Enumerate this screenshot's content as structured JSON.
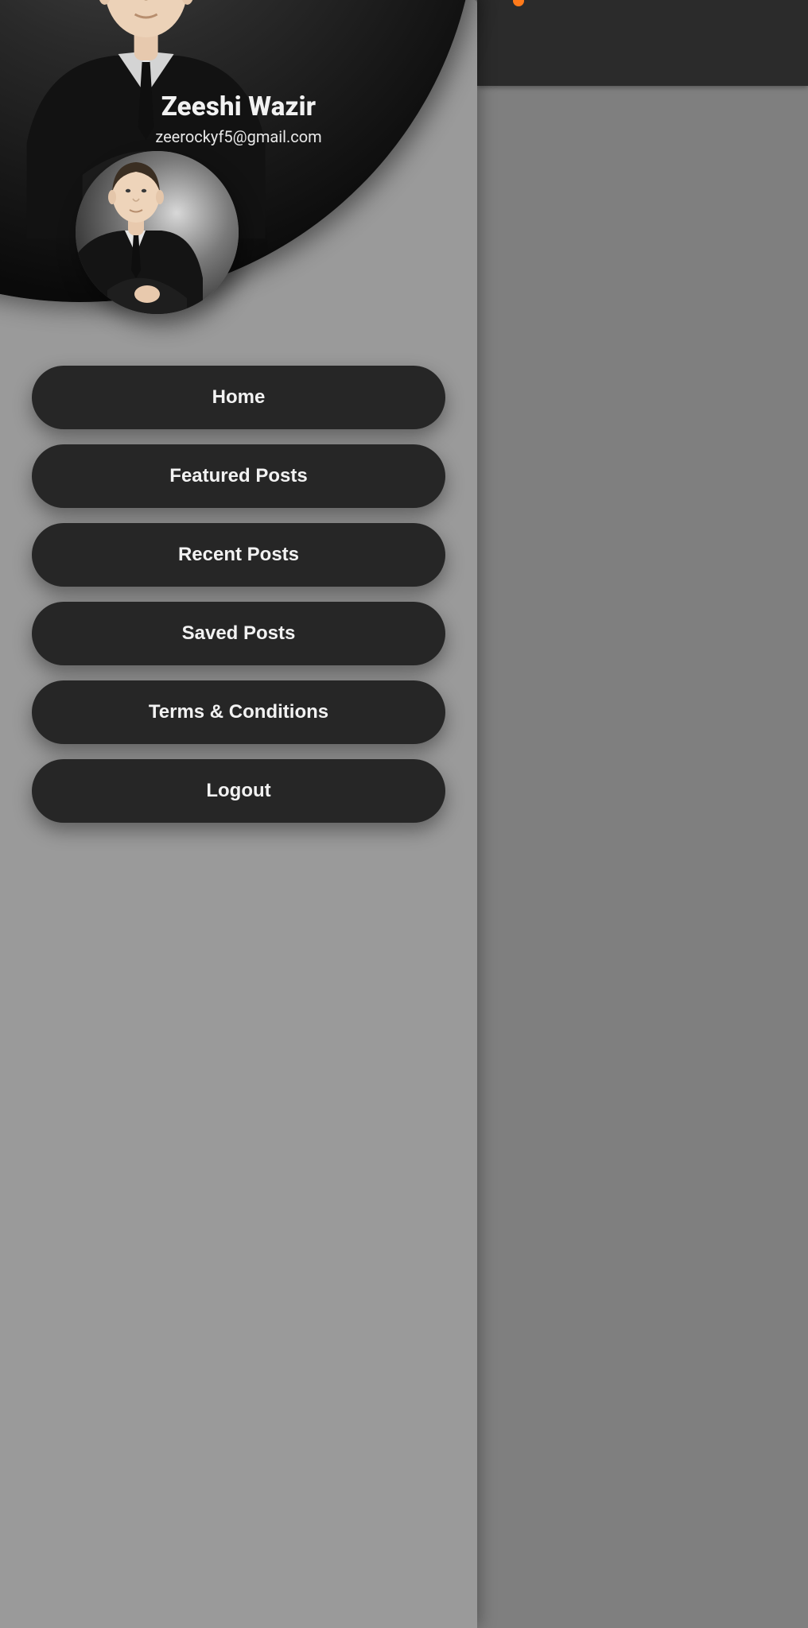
{
  "user": {
    "name": "Zeeshi Wazir",
    "email": "zeerockyf5@gmail.com"
  },
  "menu": {
    "items": [
      {
        "label": "Home"
      },
      {
        "label": "Featured Posts"
      },
      {
        "label": "Recent Posts"
      },
      {
        "label": "Saved Posts"
      },
      {
        "label": "Terms & Conditions"
      },
      {
        "label": "Logout"
      }
    ]
  },
  "colors": {
    "accent": "#ff7a1a",
    "button_bg": "#262626",
    "drawer_bg": "#9a9a9a"
  }
}
